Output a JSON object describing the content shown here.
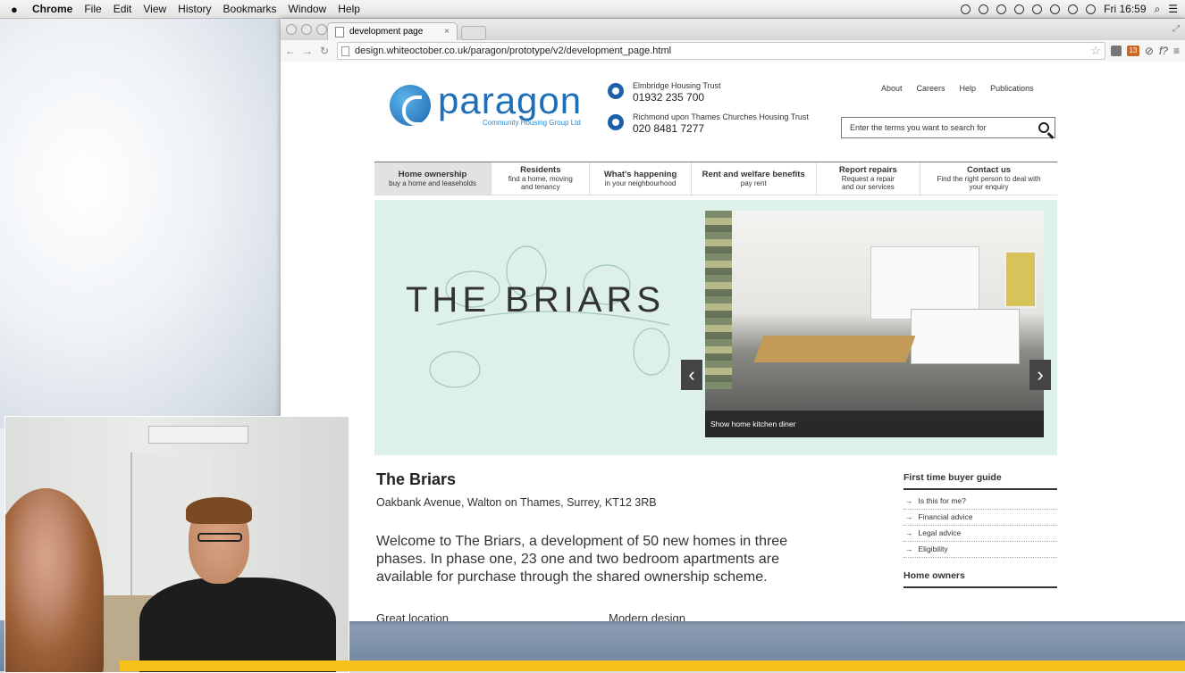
{
  "menubar": {
    "app_name": "Chrome",
    "menus": [
      "File",
      "Edit",
      "View",
      "History",
      "Bookmarks",
      "Window",
      "Help"
    ],
    "clock": "Fri 16:59"
  },
  "browser": {
    "tab_title": "development page",
    "tab_close": "×",
    "url": "design.whiteoctober.co.uk/paragon/prototype/v2/development_page.html",
    "extension_badge": "13"
  },
  "site": {
    "logo_name": "paragon",
    "logo_subtitle": "Community Housing Group Ltd",
    "contacts": [
      {
        "org": "Elmbridge Housing Trust",
        "phone": "01932 235 700"
      },
      {
        "org": "Richmond upon Thames Churches Housing Trust",
        "phone": "020 8481 7277"
      }
    ],
    "top_links": [
      "About",
      "Careers",
      "Help",
      "Publications"
    ],
    "search_placeholder": "Enter the terms you want to search for",
    "nav": [
      {
        "title": "Home ownership",
        "sub": "buy a home and leaseholds"
      },
      {
        "title": "Residents",
        "sub": "find a home, moving and tenancy"
      },
      {
        "title": "What's happening",
        "sub": "in your neighbourhood"
      },
      {
        "title": "Rent and welfare benefits",
        "sub": "pay rent"
      },
      {
        "title": "Report repairs",
        "sub": "Request a repair and our services"
      },
      {
        "title": "Contact us",
        "sub": "Find the right person to deal with your enquiry"
      }
    ],
    "hero": {
      "title": "THE BRIARS",
      "caption": "Show home kitchen diner",
      "prev": "‹",
      "next": "›"
    },
    "development": {
      "title": "The Briars",
      "address": "Oakbank Avenue, Walton on Thames, Surrey, KT12 3RB",
      "intro": "Welcome to The Briars, a development of 50 new homes in three phases. In phase one, 23 one and two bedroom apartments are available for purchase through the shared ownership scheme.",
      "subheads": [
        "Great location",
        "Modern design"
      ]
    },
    "sidebar": {
      "guide_title": "First time buyer guide",
      "guide_links": [
        "Is this for me?",
        "Financial advice",
        "Legal advice",
        "Eligibility"
      ],
      "owners_title": "Home owners"
    }
  },
  "colors": {
    "brand_blue": "#1e6fb8",
    "hero_bg": "#def0ea",
    "banner": "#f6c21a"
  }
}
